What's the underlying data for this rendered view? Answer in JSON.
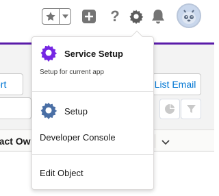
{
  "header": {
    "icons": [
      "star-icon",
      "chevron-down-icon",
      "plus-icon",
      "question-icon",
      "gear-icon",
      "bell-icon",
      "avatar"
    ],
    "help_glyph": "?"
  },
  "background": {
    "import_label": "ort",
    "email_label": "List Email",
    "column_header": "tact Ow"
  },
  "setup_menu": {
    "service_setup_label": "Service Setup",
    "service_setup_sublabel": "Setup for current app",
    "setup_label": "Setup",
    "developer_console_label": "Developer Console",
    "edit_object_label": "Edit Object"
  },
  "colors": {
    "brand_purple": "#5a1ba9",
    "service_icon": "#7526e3",
    "setup_icon": "#4a6fa5",
    "link_blue": "#0176d3"
  }
}
